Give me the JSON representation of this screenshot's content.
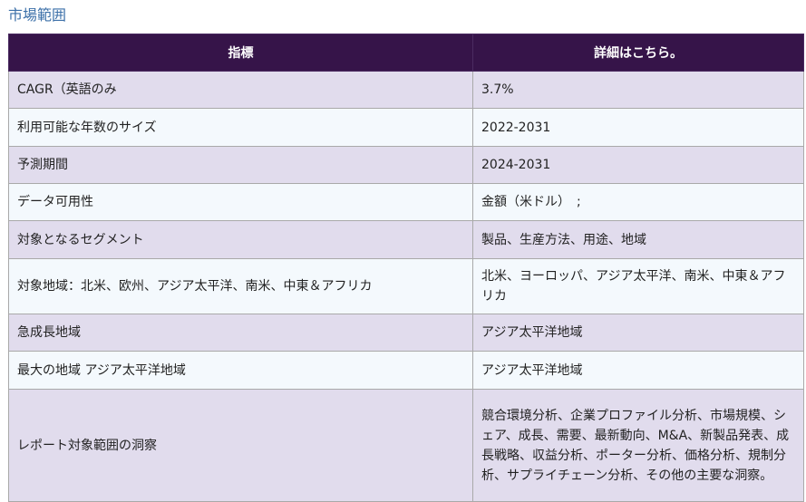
{
  "section_title": "市場範囲",
  "table": {
    "headers": [
      "指標",
      "詳細はこちら。"
    ],
    "rows": [
      [
        "CAGR（英語のみ",
        "3.7%"
      ],
      [
        "利用可能な年数のサイズ",
        "2022-2031"
      ],
      [
        "予測期間",
        "2024-2031"
      ],
      [
        "データ可用性",
        "金額（米ドル）　;"
      ],
      [
        "対象となるセグメント",
        "製品、生産方法、用途、地域"
      ],
      [
        "対象地域：北米、欧州、アジア太平洋、南米、中東＆アフリカ",
        "北米、ヨーロッパ、アジア太平洋、南米、中東＆アフリカ"
      ],
      [
        "急成長地域",
        "アジア太平洋地域"
      ],
      [
        "最大の地域 アジア太平洋地域",
        "アジア太平洋地域"
      ],
      [
        "レポート対象範囲の洞察",
        "競合環境分析、企業プロファイル分析、市場規模、シェア、成長、需要、最新動向、M&A、新製品発表、成長戦略、収益分析、ポーター分析、価格分析、規制分析、サプライチェーン分析、その他の主要な洞察。"
      ]
    ]
  }
}
